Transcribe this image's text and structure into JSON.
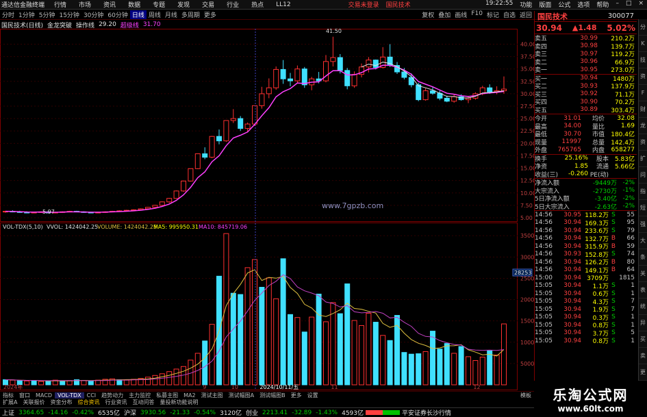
{
  "menu": {
    "app_name": "通达信金融终端",
    "items": [
      "行情",
      "市场",
      "资讯",
      "数据",
      "专题",
      "发现",
      "交易",
      "行业",
      "热点",
      "LL12"
    ],
    "trade_login": "交易未登录",
    "broker": "国民技术",
    "right_items": [
      "功能",
      "版面",
      "公式",
      "选项",
      "帮助"
    ],
    "time": "19:22:55"
  },
  "toolbar": {
    "periods": [
      "分时",
      "1分钟",
      "5分钟",
      "15分钟",
      "30分钟",
      "60分钟",
      "日线",
      "周线",
      "月线",
      "多周期",
      "更多"
    ],
    "active_period": "日线",
    "right_tools": [
      "复权",
      "叠加",
      "画线",
      "F10",
      "标记",
      "自选",
      "返回"
    ]
  },
  "infobar": {
    "stock": "国民技术(日线)",
    "indicator": "金龙突破",
    "op_label": "操作线",
    "op_value": "29.20",
    "tag_label": "超级线",
    "tag_value": "31.70"
  },
  "price_axis": [
    "40.00",
    "37.50",
    "35.00",
    "32.50",
    "30.00",
    "27.50",
    "25.00",
    "22.50",
    "20.00",
    "17.50",
    "15.00",
    "12.50",
    "10.00",
    "7.50",
    "5.00"
  ],
  "vol_axis": [
    "35000",
    "30000",
    "25000",
    "20000",
    "15000",
    "10000",
    "5000"
  ],
  "vol_cursor": "28253",
  "annotations": {
    "high": "41.50",
    "low": "5.97",
    "watermark": "www.7gpzb.com"
  },
  "vol_header": {
    "name": "VOL-TDX(5,10)",
    "vol": "VVOL: 1424042.25",
    "volume": "VOLUME: 1424042.25",
    "ma5": "MA5: 995950.31",
    "ma10": "MA10: 845719.06"
  },
  "date_axis": [
    "2024年",
    "9",
    "10",
    "2024/10/11/五",
    "11",
    "12"
  ],
  "chart_data": [
    {
      "type": "candlestick",
      "title": "国民技术(日线)",
      "ylim": [
        5,
        42
      ],
      "candles": [
        [
          6.2,
          6.4,
          6.0,
          6.3
        ],
        [
          6.3,
          6.5,
          6.1,
          6.2
        ],
        [
          6.2,
          6.4,
          6.0,
          6.1
        ],
        [
          6.1,
          6.3,
          5.9,
          6.0
        ],
        [
          6.0,
          6.2,
          5.97,
          6.1
        ],
        [
          6.1,
          6.3,
          6.0,
          6.2
        ],
        [
          6.2,
          6.3,
          6.0,
          6.0
        ],
        [
          6.0,
          6.2,
          5.9,
          6.1
        ],
        [
          6.1,
          6.3,
          6.0,
          6.2
        ],
        [
          6.2,
          6.4,
          6.1,
          6.3
        ],
        [
          6.3,
          6.4,
          6.1,
          6.2
        ],
        [
          6.2,
          6.3,
          6.0,
          6.1
        ],
        [
          6.1,
          6.2,
          5.97,
          6.0
        ],
        [
          6.0,
          6.2,
          5.9,
          6.1
        ],
        [
          6.1,
          6.3,
          6.0,
          6.2
        ],
        [
          6.2,
          6.4,
          6.1,
          6.3
        ],
        [
          6.3,
          6.5,
          6.2,
          6.4
        ],
        [
          6.4,
          6.6,
          6.3,
          6.5
        ],
        [
          6.5,
          6.7,
          6.4,
          6.6
        ],
        [
          6.6,
          6.9,
          6.5,
          6.8
        ],
        [
          6.8,
          7.2,
          6.7,
          7.1
        ],
        [
          7.1,
          7.6,
          7.0,
          7.5
        ],
        [
          7.5,
          8.3,
          7.4,
          8.2
        ],
        [
          8.2,
          9.0,
          8.0,
          8.9
        ],
        [
          8.9,
          10.5,
          8.8,
          10.4
        ],
        [
          10.4,
          12.5,
          10.2,
          12.4
        ],
        [
          12.4,
          14.9,
          12.3,
          14.9
        ],
        [
          14.9,
          17.9,
          14.8,
          17.9
        ],
        [
          17.9,
          19.2,
          16.8,
          17.2
        ],
        [
          17.2,
          21.5,
          17.0,
          21.4
        ],
        [
          21.4,
          22.8,
          19.8,
          20.5
        ],
        [
          20.5,
          24.6,
          20.3,
          24.6
        ],
        [
          24.6,
          26.9,
          24.1,
          25.0
        ],
        [
          25.0,
          25.5,
          22.5,
          23.0
        ],
        [
          23.0,
          24.2,
          22.3,
          23.9
        ],
        [
          23.9,
          27.6,
          23.5,
          27.6
        ],
        [
          27.6,
          31.4,
          27.0,
          30.0
        ],
        [
          30.0,
          33.1,
          29.1,
          31.2
        ],
        [
          31.2,
          35.5,
          30.8,
          34.9
        ],
        [
          34.9,
          36.8,
          32.0,
          33.0
        ],
        [
          33.0,
          34.2,
          31.5,
          32.6
        ],
        [
          32.6,
          35.7,
          32.2,
          35.0
        ],
        [
          35.0,
          35.4,
          31.2,
          31.8
        ],
        [
          31.8,
          33.4,
          30.7,
          33.0
        ],
        [
          33.0,
          34.4,
          32.1,
          32.6
        ],
        [
          32.6,
          37.8,
          32.3,
          36.5
        ],
        [
          36.5,
          41.5,
          35.5,
          37.3
        ],
        [
          37.3,
          38.0,
          34.1,
          34.7
        ],
        [
          34.7,
          35.2,
          30.9,
          31.6
        ],
        [
          31.6,
          34.5,
          31.2,
          33.9
        ],
        [
          33.9,
          36.1,
          33.3,
          35.4
        ],
        [
          35.4,
          37.4,
          34.3,
          36.8
        ],
        [
          36.8,
          36.9,
          34.9,
          35.3
        ],
        [
          35.3,
          39.4,
          35.1,
          37.4
        ],
        [
          37.4,
          40.0,
          35.4,
          35.7
        ],
        [
          35.7,
          36.4,
          34.0,
          34.4
        ],
        [
          34.4,
          35.2,
          32.9,
          33.3
        ],
        [
          33.3,
          34.1,
          31.3,
          31.8
        ],
        [
          31.8,
          32.2,
          28.5,
          28.8
        ],
        [
          28.8,
          31.1,
          28.6,
          30.6
        ],
        [
          30.6,
          31.3,
          29.8,
          30.1
        ],
        [
          30.1,
          30.6,
          28.7,
          29.1
        ],
        [
          29.1,
          29.6,
          28.3,
          28.5
        ],
        [
          28.5,
          29.8,
          28.2,
          29.4
        ],
        [
          29.4,
          29.9,
          28.6,
          28.8
        ],
        [
          28.8,
          29.5,
          28.1,
          29.1
        ],
        [
          29.1,
          30.3,
          28.8,
          30.0
        ],
        [
          30.0,
          31.6,
          29.7,
          31.2
        ],
        [
          31.2,
          31.9,
          30.0,
          30.4
        ],
        [
          30.4,
          31.5,
          29.9,
          30.6
        ],
        [
          30.6,
          33.5,
          30.0,
          30.94
        ]
      ]
    },
    {
      "type": "bar",
      "title": "VOL-TDX(5,10)",
      "ylim": [
        0,
        36000
      ],
      "values": [
        1200,
        1100,
        1000,
        900,
        1000,
        800,
        900,
        1100,
        900,
        1000,
        1200,
        1000,
        900,
        1100,
        1300,
        1400,
        1200,
        1100,
        1300,
        1500,
        1800,
        2200,
        2600,
        3100,
        3700,
        4300,
        5800,
        7400,
        10300,
        14200,
        25500,
        35500,
        21500,
        21200,
        27500,
        29400,
        22900,
        25100,
        20200,
        29600,
        16500,
        15800,
        12400,
        15900,
        21300,
        14800,
        19300,
        16700,
        23700,
        15100,
        13900,
        16800,
        14700,
        11600,
        10400,
        16300,
        7600,
        7200,
        7300,
        7800,
        12600,
        8400,
        9700,
        7400,
        9000,
        6600,
        5700,
        6500,
        8000,
        7000,
        14300
      ],
      "bar_types": [
        "d",
        "u",
        "d",
        "u",
        "d",
        "u",
        "d",
        "u",
        "d",
        "u",
        "d",
        "u",
        "d",
        "u",
        "u",
        "u",
        "d",
        "u",
        "u",
        "u",
        "u",
        "u",
        "u",
        "u",
        "u",
        "u",
        "u",
        "u",
        "d",
        "u",
        "d",
        "u",
        "d",
        "d",
        "u",
        "u",
        "d",
        "u",
        "u",
        "d",
        "d",
        "u",
        "d",
        "u",
        "d",
        "u",
        "u",
        "d",
        "d",
        "u",
        "u",
        "u",
        "d",
        "u",
        "d",
        "d",
        "d",
        "d",
        "d",
        "u",
        "d",
        "d",
        "d",
        "u",
        "d",
        "u",
        "u",
        "u",
        "d",
        "u",
        "u"
      ]
    }
  ],
  "quote": {
    "name": "国民技术",
    "code": "300077",
    "price": "30.94",
    "change": "1.48",
    "pct": "5.02%",
    "asks": [
      {
        "label": "卖五",
        "price": "30.99",
        "vol": "210.2万"
      },
      {
        "label": "卖四",
        "price": "30.98",
        "vol": "139.7万"
      },
      {
        "label": "卖三",
        "price": "30.97",
        "vol": "119.2万"
      },
      {
        "label": "卖二",
        "price": "30.96",
        "vol": "66.9万"
      },
      {
        "label": "卖一",
        "price": "30.95",
        "vol": "273.0万"
      }
    ],
    "bids": [
      {
        "label": "买一",
        "price": "30.94",
        "vol": "1480万"
      },
      {
        "label": "买二",
        "price": "30.93",
        "vol": "137.9万"
      },
      {
        "label": "买三",
        "price": "30.92",
        "vol": "71.1万"
      },
      {
        "label": "买四",
        "price": "30.90",
        "vol": "70.2万"
      },
      {
        "label": "买五",
        "price": "30.89",
        "vol": "303.4万"
      }
    ],
    "stats": [
      {
        "l1": "今开",
        "v1": "31.01",
        "l2": "均价",
        "v2": "32.08"
      },
      {
        "l1": "最高",
        "v1": "34.00",
        "l2": "量比",
        "v2": "1.69"
      },
      {
        "l1": "最低",
        "v1": "30.70",
        "l2": "市值",
        "v2": "180.4亿"
      },
      {
        "l1": "现量",
        "v1": "11997",
        "l2": "总量",
        "v2": "142.4万"
      },
      {
        "l1": "外盘",
        "v1": "765765",
        "l2": "内盘",
        "v2": "658277"
      }
    ],
    "stats2": [
      {
        "l1": "换手",
        "v1": "25.16%",
        "l2": "股本",
        "v2": "5.83亿"
      },
      {
        "l1": "净资",
        "v1": "1.85",
        "l2": "流通",
        "v2": "5.66亿"
      },
      {
        "l1": "收益(三)",
        "v1": "-0.260",
        "l2": "PE(动)",
        "v2": ""
      }
    ],
    "flows": [
      {
        "label": "净流入额",
        "value": "-9449万",
        "pct": "-2%"
      },
      {
        "label": "大宗流入",
        "value": "-2730万",
        "pct": "-1%"
      },
      {
        "label": "5日净流入额",
        "value": "-3.40亿",
        "pct": "-2%"
      },
      {
        "label": "5日大宗流入",
        "value": "-2.63亿",
        "pct": "-2%"
      }
    ],
    "ticks": [
      {
        "t": "14:56",
        "p": "30.95",
        "v": "118.2万",
        "s": "S",
        "n": "55"
      },
      {
        "t": "14:56",
        "p": "30.94",
        "v": "169.3万",
        "s": "S",
        "n": "95"
      },
      {
        "t": "14:56",
        "p": "30.94",
        "v": "233.6万",
        "s": "S",
        "n": "79"
      },
      {
        "t": "14:56",
        "p": "30.94",
        "v": "132.7万",
        "s": "B",
        "n": "66"
      },
      {
        "t": "14:56",
        "p": "30.94",
        "v": "315.9万",
        "s": "B",
        "n": "59"
      },
      {
        "t": "14:56",
        "p": "30.93",
        "v": "152.8万",
        "s": "S",
        "n": "74"
      },
      {
        "t": "14:56",
        "p": "30.94",
        "v": "126.2万",
        "s": "B",
        "n": "80"
      },
      {
        "t": "14:56",
        "p": "30.94",
        "v": "149.1万",
        "s": "B",
        "n": "64"
      },
      {
        "t": "15:00",
        "p": "30.94",
        "v": "3709万",
        "s": "",
        "n": "1815"
      },
      {
        "t": "15:05",
        "p": "30.94",
        "v": "1.1万",
        "s": "S",
        "n": "1"
      },
      {
        "t": "15:05",
        "p": "30.94",
        "v": "0.6万",
        "s": "S",
        "n": "1"
      },
      {
        "t": "15:05",
        "p": "30.94",
        "v": "4.3万",
        "s": "S",
        "n": "7"
      },
      {
        "t": "15:05",
        "p": "30.94",
        "v": "1.9万",
        "s": "S",
        "n": "7"
      },
      {
        "t": "15:05",
        "p": "30.94",
        "v": "0.3万",
        "s": "S",
        "n": "1"
      },
      {
        "t": "15:05",
        "p": "30.94",
        "v": "0.8万",
        "s": "S",
        "n": "1"
      },
      {
        "t": "15:05",
        "p": "30.94",
        "v": "3.7万",
        "s": "S",
        "n": "5"
      },
      {
        "t": "15:05",
        "p": "30.94",
        "v": "0.8万",
        "s": "S",
        "n": "1"
      }
    ]
  },
  "chart_tabs": [
    "指标",
    "窗口",
    "MACD",
    "VOL-TDX",
    "CCI",
    "趋势动力",
    "主力监控",
    "私募主图",
    "MA2",
    "测试主图",
    "测试幅图A",
    "测试幅图B",
    "更多",
    "设置"
  ],
  "chart_tabs_active": "VOL-TDX",
  "chart_tabs_right": "模板",
  "bottom_tabs": [
    "扩展A",
    "关联报价",
    "资金分布",
    "综合资讯",
    "行业资讯",
    "互动问答",
    "量投新功能说明"
  ],
  "bottom_tabs_active": "综合资讯",
  "status": {
    "sh_label": "上证",
    "sh_val": "3364.65",
    "sh_chg": "-14.16",
    "sh_pct": "-0.42%",
    "sh_amt": "6535亿",
    "sz_label": "沪深",
    "sz_val": "3930.56",
    "sz_chg": "-21.33",
    "sz_pct": "-0.54%",
    "sz_amt": "3120亿",
    "cy_label": "创业",
    "cy_val": "2213.41",
    "cy_chg": "-32.89",
    "cy_pct": "-1.43%",
    "cy_amt": "4593亿",
    "broker_info": "平安证券长沙行情"
  },
  "logo": {
    "line1": "乐淘公式网",
    "line2": "www.60lt.com"
  },
  "sidebar": [
    "分",
    "K",
    "技",
    "资",
    "F",
    "财",
    "龙",
    "资",
    "扩",
    "问",
    "指",
    "短",
    "强",
    "大",
    "条",
    "关",
    "表",
    "统",
    "异",
    "买",
    "卖",
    "更"
  ]
}
